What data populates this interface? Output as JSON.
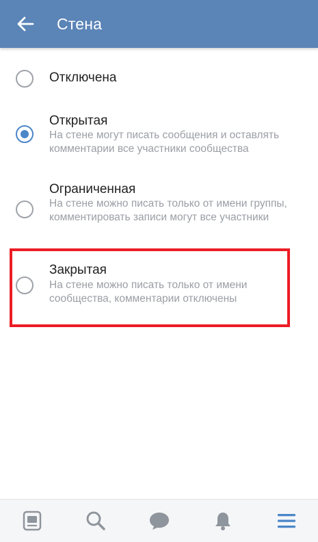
{
  "appbar": {
    "title": "Стена",
    "back_icon": "arrow-left-icon",
    "color": "#5b84b7"
  },
  "options": [
    {
      "title": "Отключена",
      "description": "",
      "selected": false
    },
    {
      "title": "Открытая",
      "description": "На стене могут писать сообщения и оставлять комментарии все участники сообщества",
      "selected": true
    },
    {
      "title": "Ограниченная",
      "description": "На стене можно писать только от имени группы, комментировать записи могут все участники",
      "selected": false
    },
    {
      "title": "Закрытая",
      "description": "На стене можно писать только от имени сообщества, комментарии отключены",
      "selected": false
    }
  ],
  "highlight_color": "#ec1c24",
  "accent_color": "#4a86c8",
  "bottom_nav": [
    {
      "icon": "news-icon"
    },
    {
      "icon": "search-icon"
    },
    {
      "icon": "messages-icon"
    },
    {
      "icon": "notifications-icon"
    },
    {
      "icon": "menu-icon",
      "active": true
    }
  ]
}
